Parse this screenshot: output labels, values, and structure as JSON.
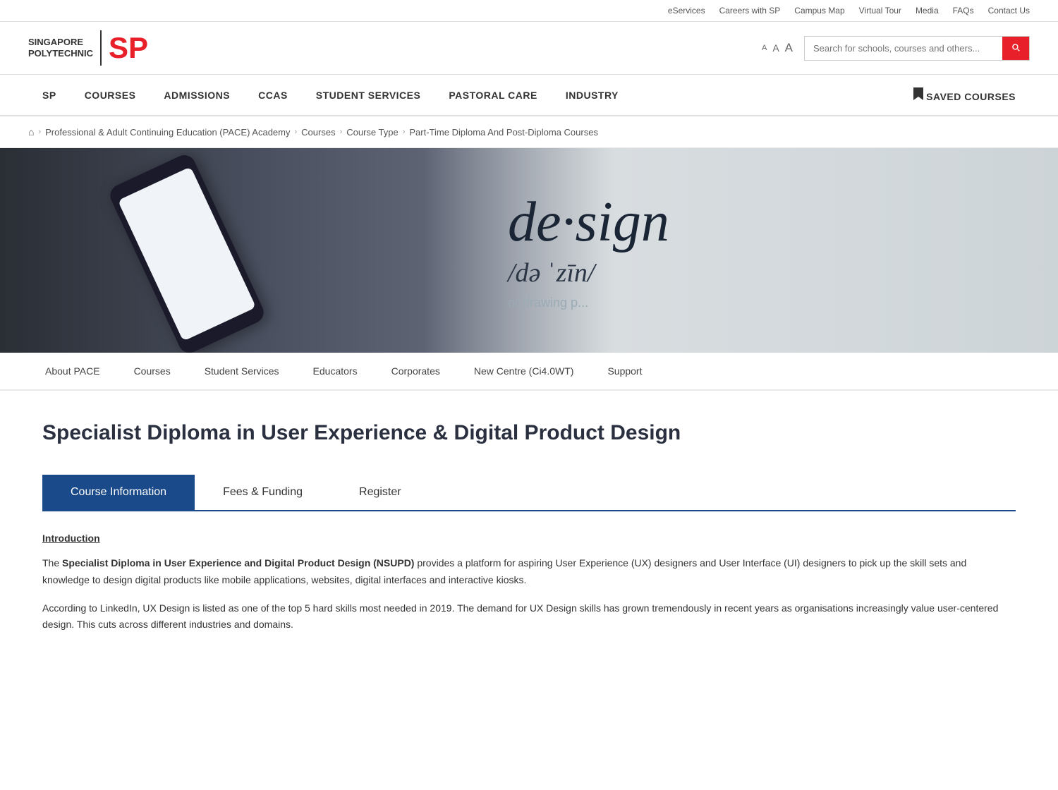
{
  "topbar": {
    "links": [
      {
        "label": "eServices",
        "key": "eservices"
      },
      {
        "label": "Careers with SP",
        "key": "careers"
      },
      {
        "label": "Campus Map",
        "key": "campus-map"
      },
      {
        "label": "Virtual Tour",
        "key": "virtual-tour"
      },
      {
        "label": "Media",
        "key": "media"
      },
      {
        "label": "FAQs",
        "key": "faqs"
      },
      {
        "label": "Contact Us",
        "key": "contact"
      }
    ]
  },
  "logo": {
    "line1": "SINGAPORE",
    "line2": "POLYTECHNIC",
    "sp_red": "SP"
  },
  "font_sizes": {
    "small": "A",
    "medium": "A",
    "large": "A"
  },
  "search": {
    "placeholder": "Search for schools, courses and others..."
  },
  "main_nav": {
    "items": [
      {
        "label": "SP",
        "key": "sp"
      },
      {
        "label": "COURSES",
        "key": "courses"
      },
      {
        "label": "ADMISSIONS",
        "key": "admissions"
      },
      {
        "label": "CCAS",
        "key": "ccas"
      },
      {
        "label": "STUDENT SERVICES",
        "key": "student-services"
      },
      {
        "label": "PASTORAL CARE",
        "key": "pastoral-care"
      },
      {
        "label": "INDUSTRY",
        "key": "industry"
      }
    ],
    "saved_courses": "SAVED COURSES"
  },
  "breadcrumb": {
    "home_symbol": "⌂",
    "items": [
      {
        "label": "Professional & Adult Continuing Education (PACE) Academy",
        "key": "pace"
      },
      {
        "label": "Courses",
        "key": "courses"
      },
      {
        "label": "Course Type",
        "key": "course-type"
      },
      {
        "label": "Part-Time Diploma And Post-Diploma Courses",
        "key": "part-time"
      }
    ]
  },
  "hero": {
    "design_word": "de·sign",
    "design_phonetic": "/də ˈzīn/",
    "subtitle": "or drawing p"
  },
  "pace_nav": {
    "items": [
      {
        "label": "About PACE",
        "key": "about-pace"
      },
      {
        "label": "Courses",
        "key": "courses"
      },
      {
        "label": "Student Services",
        "key": "student-services"
      },
      {
        "label": "Educators",
        "key": "educators"
      },
      {
        "label": "Corporates",
        "key": "corporates"
      },
      {
        "label": "New Centre (Ci4.0WT)",
        "key": "new-centre"
      },
      {
        "label": "Support",
        "key": "support"
      }
    ]
  },
  "course": {
    "title": "Specialist Diploma in User Experience & Digital Product Design",
    "tabs": [
      {
        "label": "Course Information",
        "key": "course-info",
        "active": true
      },
      {
        "label": "Fees & Funding",
        "key": "fees-funding",
        "active": false
      },
      {
        "label": "Register",
        "key": "register",
        "active": false
      }
    ],
    "intro_heading": "Introduction",
    "intro_paragraph1_before": "The ",
    "intro_paragraph1_bold": "Specialist Diploma in User Experience and Digital Product Design (NSUPD)",
    "intro_paragraph1_after": " provides a platform for aspiring User Experience (UX) designers and User Interface (UI) designers to pick up the skill sets and knowledge to design digital products like mobile applications, websites, digital interfaces and interactive kiosks.",
    "intro_paragraph2": "According to LinkedIn, UX Design is listed as one of the top 5 hard skills most needed in 2019. The demand for UX Design skills has grown tremendously in recent years as organisations increasingly value user-centered design. This cuts across different industries and domains."
  }
}
